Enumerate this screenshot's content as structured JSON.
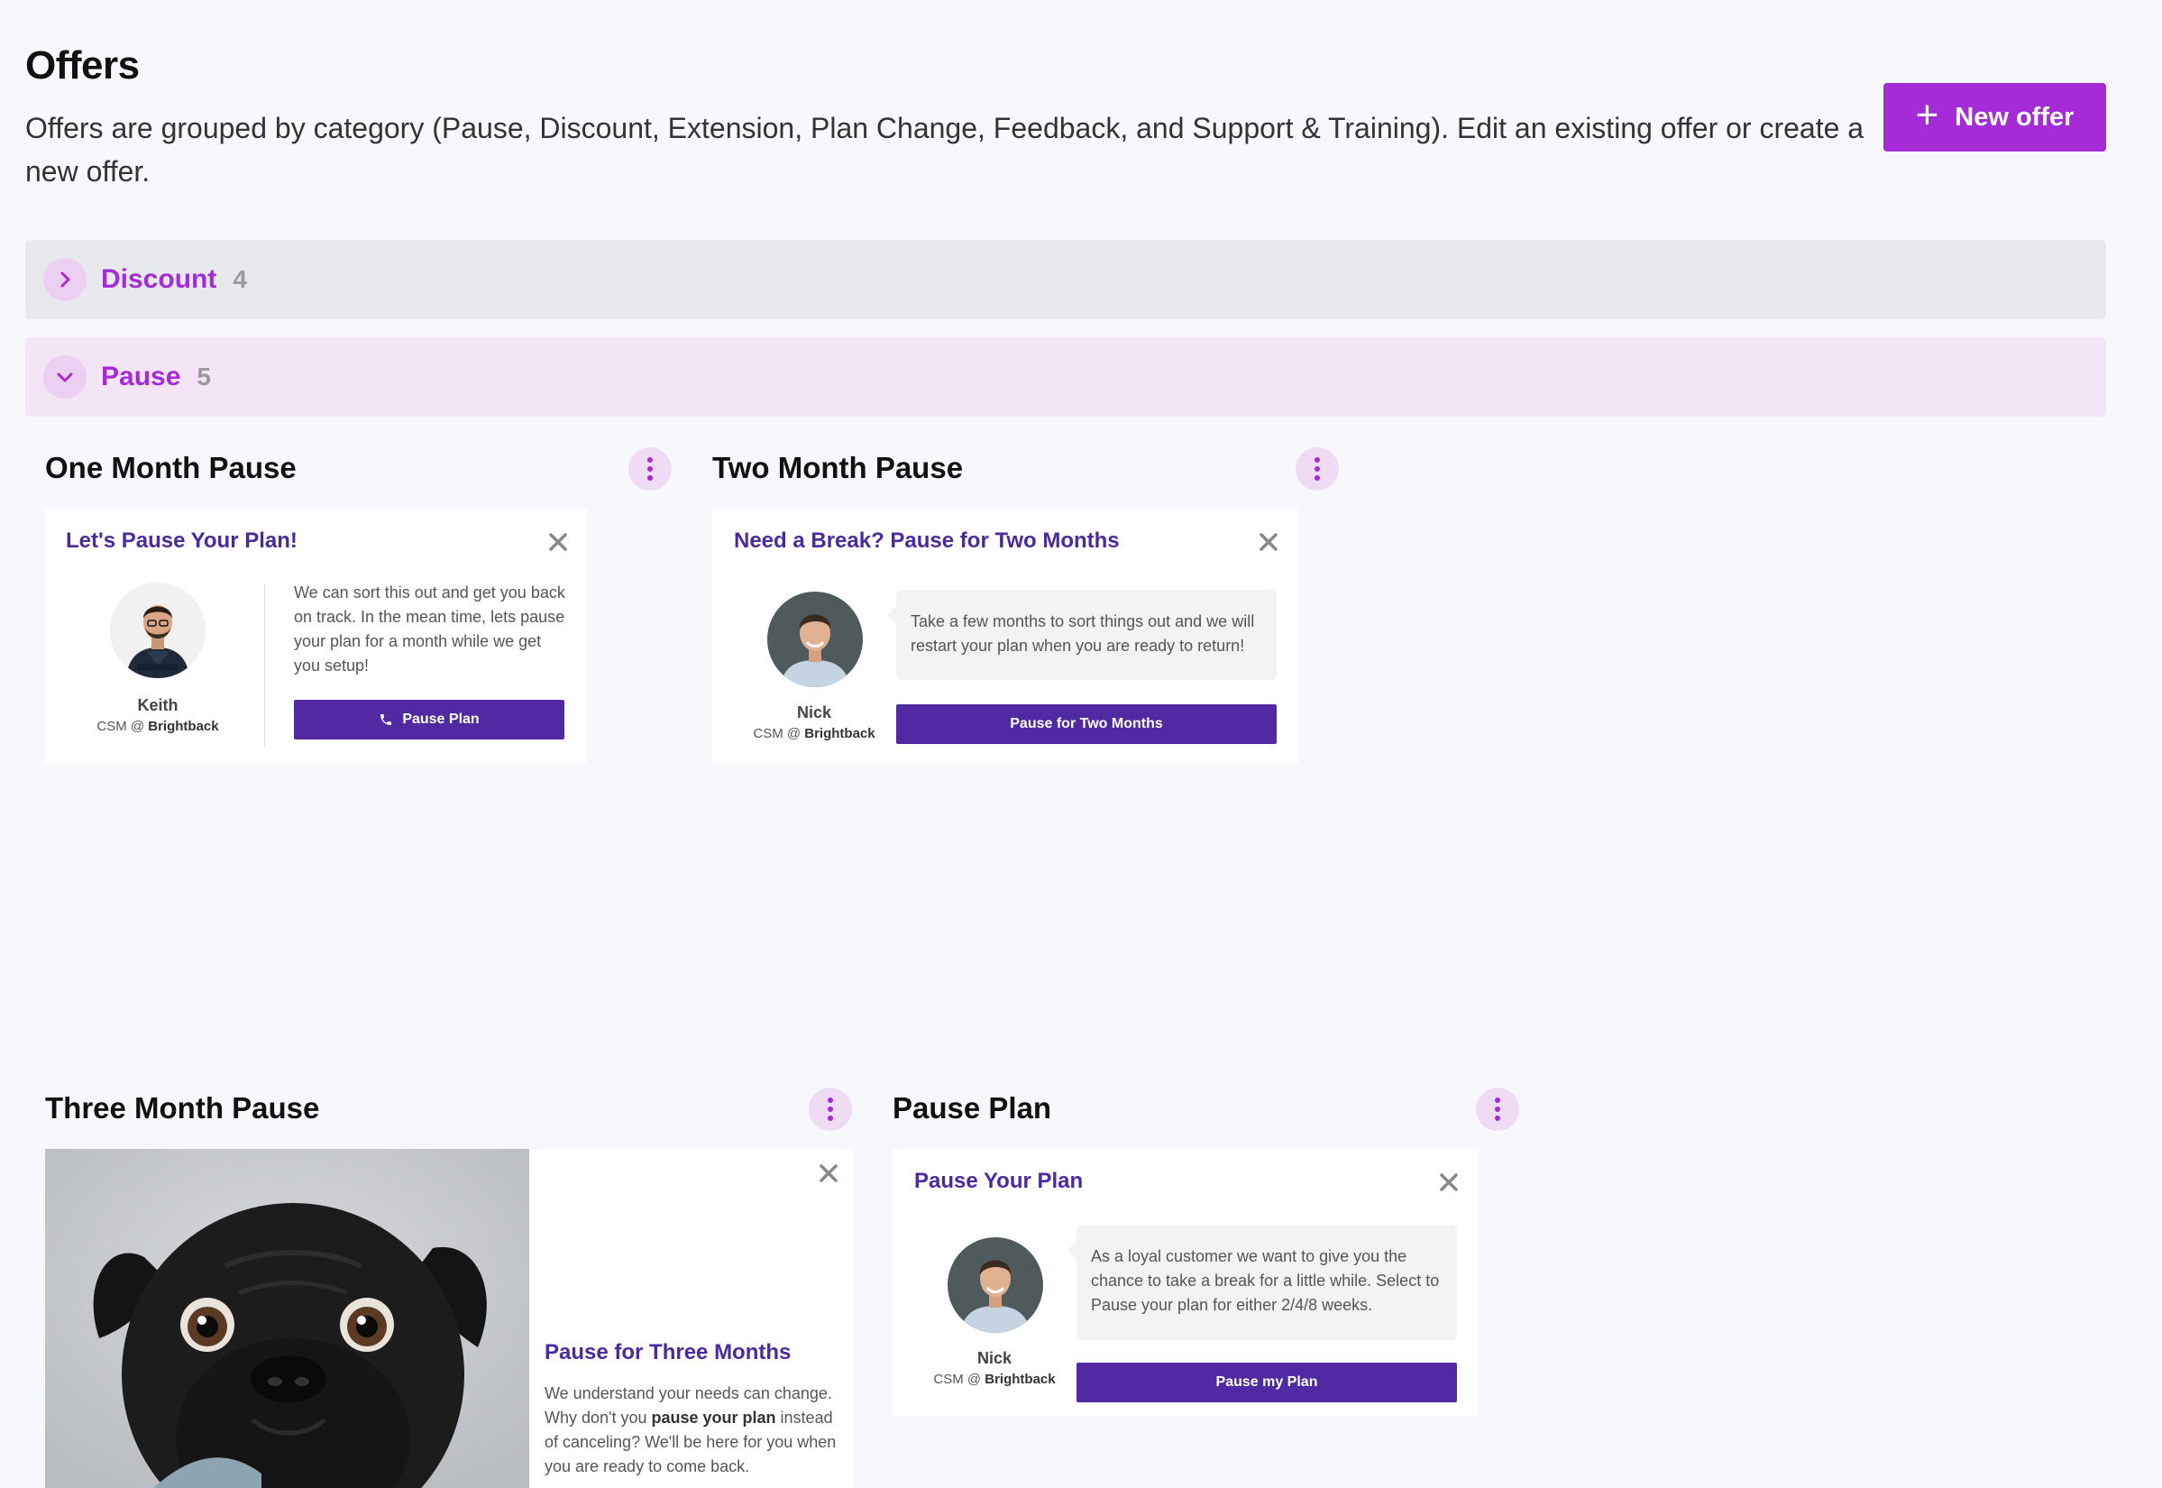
{
  "header": {
    "title": "Offers",
    "description": "Offers are grouped by category (Pause, Discount, Extension, Plan Change, Feedback, and Support & Training). Edit an existing offer or create a new offer.",
    "new_offer_label": "New offer"
  },
  "categories": [
    {
      "name": "Discount",
      "count": "4",
      "expanded": false
    },
    {
      "name": "Pause",
      "count": "5",
      "expanded": true
    }
  ],
  "offers": [
    {
      "title": "One Month Pause",
      "card": {
        "heading": "Let's Pause Your Plan!",
        "person_name": "Keith",
        "person_role_prefix": "CSM @ ",
        "person_company": "Brightback",
        "message": "We can sort this out and get you back on track. In the mean time, lets pause your plan for a month while we get you setup!",
        "button": "Pause Plan",
        "button_icon": "phone-icon"
      }
    },
    {
      "title": "Two Month Pause",
      "card": {
        "heading": "Need a Break? Pause for Two Months",
        "person_name": "Nick",
        "person_role_prefix": "CSM @ ",
        "person_company": "Brightback",
        "message": "Take a few months to sort things out and we will restart your plan when you are ready to return!",
        "button": "Pause for Two Months"
      }
    },
    {
      "title": "Three Month Pause",
      "card": {
        "heading": "Pause for Three Months",
        "message_part1": "We understand your needs can change. Why don't you ",
        "message_bold": "pause your plan",
        "message_part2": " instead of canceling? We'll be here for you when you are ready to come back.",
        "image": "pug-photo"
      }
    },
    {
      "title": "Pause Plan",
      "card": {
        "heading": "Pause Your Plan",
        "person_name": "Nick",
        "person_role_prefix": "CSM @ ",
        "person_company": "Brightback",
        "message": "As a loyal customer we want to give you the chance to take a break for a little while. Select to Pause your plan for either 2/4/8 weeks.",
        "button": "Pause my Plan"
      }
    }
  ],
  "colors": {
    "accent": "#a52bd6",
    "card_heading": "#4b2aa0",
    "cta": "#5029a3",
    "background": "#f7f8fb"
  }
}
